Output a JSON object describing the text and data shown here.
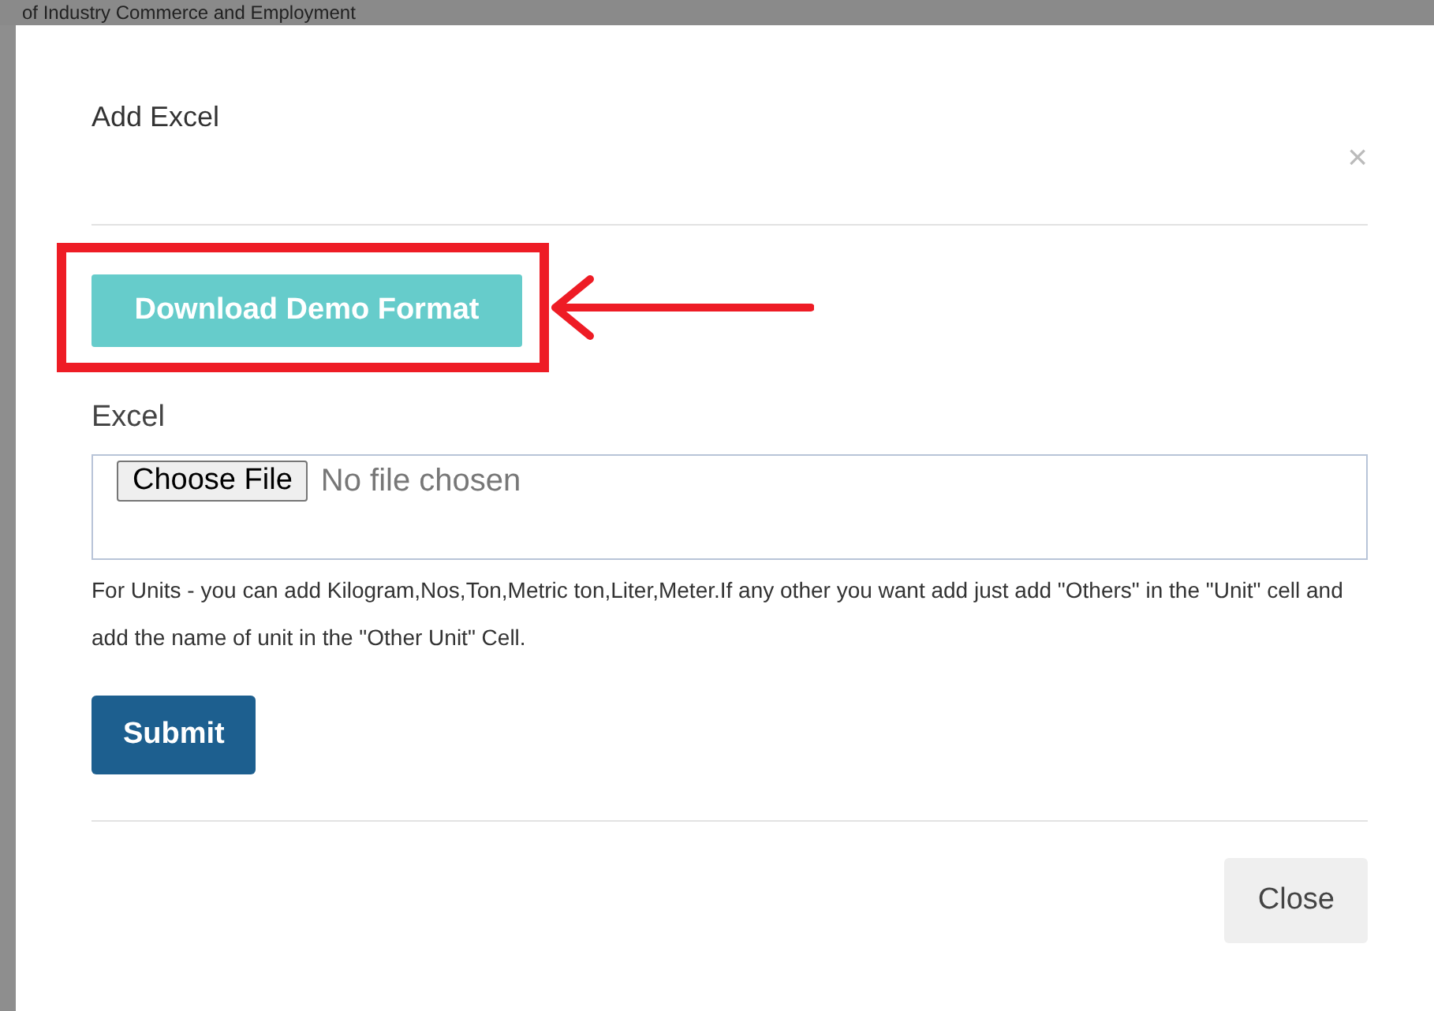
{
  "backdrop": {
    "heading": "of Industry Commerce and Employment"
  },
  "dialog": {
    "title": "Add Excel",
    "close_symbol": "×",
    "download_button": {
      "label": "Download Demo Format",
      "highlighted": true
    },
    "field": {
      "label": "Excel",
      "file_button": "Choose File",
      "file_status": "No file chosen"
    },
    "help_text": "For Units - you can add Kilogram,Nos,Ton,Metric ton,Liter,Meter.If any other you want add just add \"Others\" in the \"Unit\" cell and add the name of unit in the \"Other Unit\" Cell.",
    "submit_button": "Submit",
    "footer_button": "Close"
  }
}
